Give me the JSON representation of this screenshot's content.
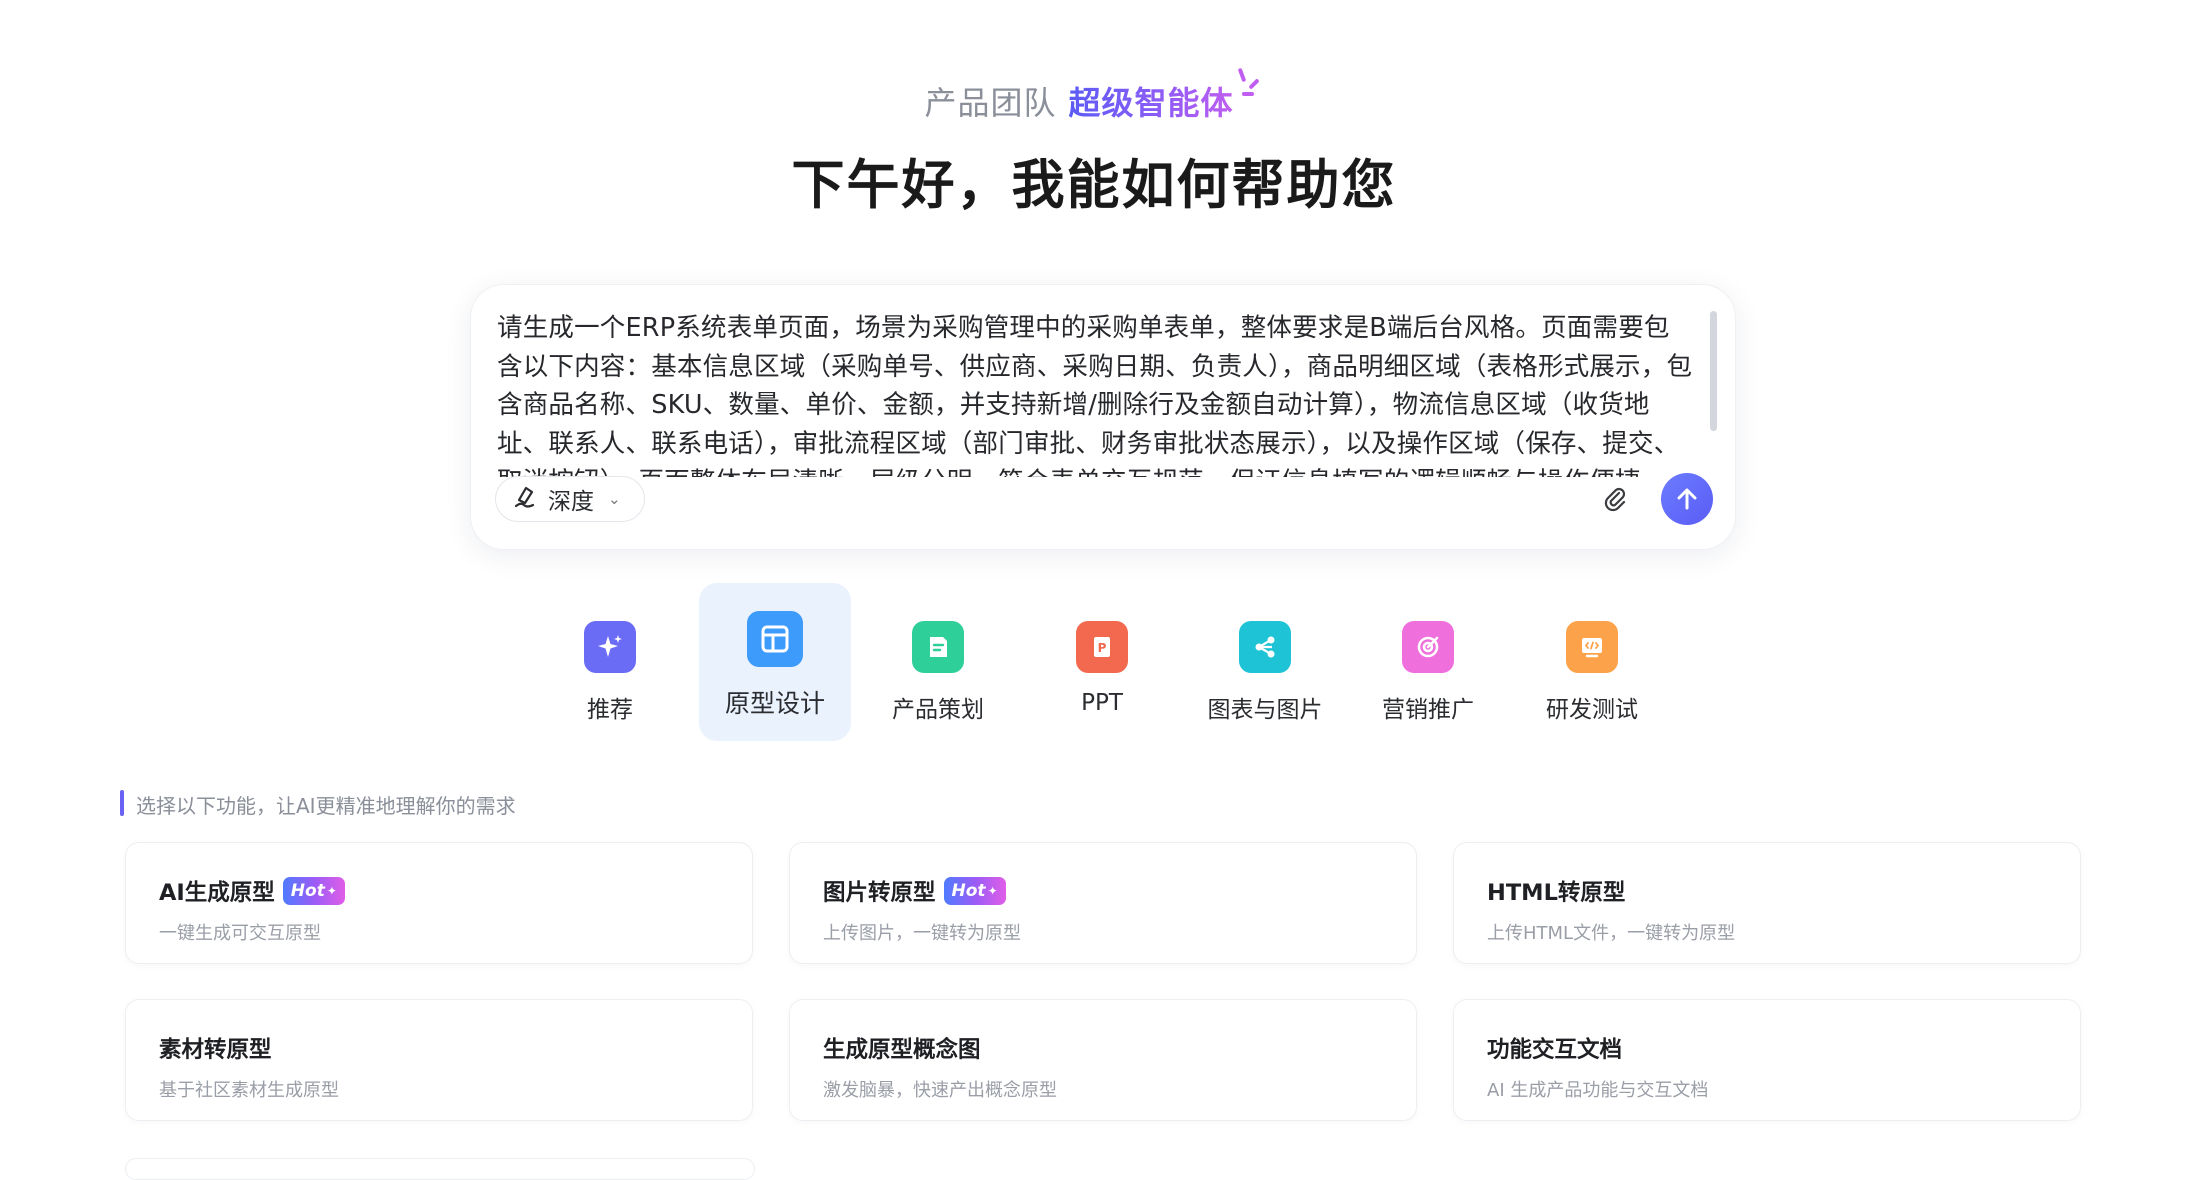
{
  "header": {
    "tagline_prefix": "产品团队",
    "tagline_brand": "超级智能体",
    "greeting": "下午好，我能如何帮助您"
  },
  "prompt": {
    "text": "请生成一个ERP系统表单页面，场景为采购管理中的采购单表单，整体要求是B端后台风格。页面需要包含以下内容：基本信息区域（采购单号、供应商、采购日期、负责人），商品明细区域（表格形式展示，包含商品名称、SKU、数量、单价、金额，并支持新增/删除行及金额自动计算），物流信息区域（收货地址、联系人、联系电话），审批流程区域（部门审批、财务审批状态展示），以及操作区域（保存、提交、取消按钮）。页面整体布局清晰，层级分明，符合表单交互规范，保证信息填写的逻辑顺畅与操作便捷。",
    "scroll_position": 0.0
  },
  "mode_selector": {
    "label": "深度"
  },
  "categories": [
    {
      "label": "推荐",
      "icon": "sparkle-icon",
      "color": "#6b6cf6"
    },
    {
      "label": "原型设计",
      "icon": "layout-icon",
      "color": "#3d9bfb",
      "active": true
    },
    {
      "label": "产品策划",
      "icon": "document-icon",
      "color": "#2fcf99"
    },
    {
      "label": "PPT",
      "icon": "ppt-icon",
      "color": "#f2694f"
    },
    {
      "label": "图表与图片",
      "icon": "share-icon",
      "color": "#1ec4d6"
    },
    {
      "label": "营销推广",
      "icon": "target-icon",
      "color": "#ef6fdc"
    },
    {
      "label": "研发测试",
      "icon": "code-icon",
      "color": "#fba24a"
    }
  ],
  "section_hint": "选择以下功能，让AI更精准地理解你的需求",
  "features": [
    {
      "title": "AI生成原型",
      "desc": "一键生成可交互原型",
      "badge": "Hot"
    },
    {
      "title": "图片转原型",
      "desc": "上传图片，一键转为原型",
      "badge": "Hot"
    },
    {
      "title": "HTML转原型",
      "desc": "上传HTML文件，一键转为原型",
      "badge": ""
    },
    {
      "title": "素材转原型",
      "desc": "基于社区素材生成原型",
      "badge": ""
    },
    {
      "title": "生成原型概念图",
      "desc": "激发脑暴，快速产出概念原型",
      "badge": ""
    },
    {
      "title": "功能交互文档",
      "desc": "AI 生成产品功能与交互文档",
      "badge": ""
    }
  ],
  "colors": {
    "accent": "#5b5cf5",
    "brand_gradient_end": "#c05ef1",
    "active_tab_bg": "#eaf2fe"
  }
}
